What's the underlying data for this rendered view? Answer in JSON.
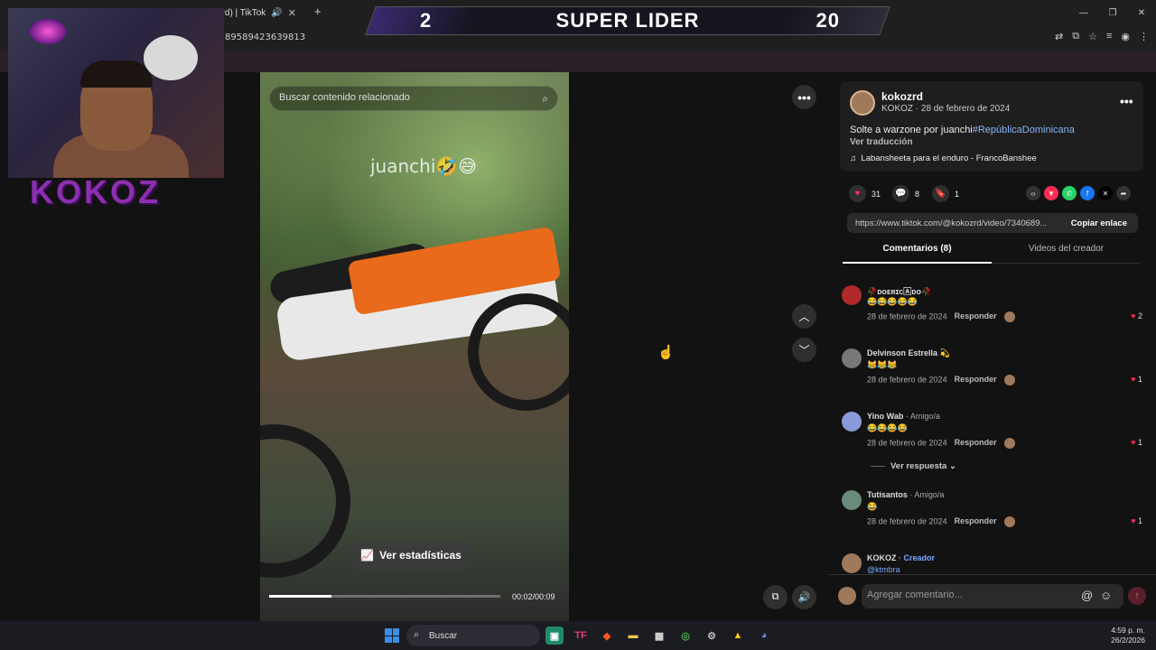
{
  "browser": {
    "tab_title": "kozrd) | TikTok",
    "url": "89589423639813"
  },
  "overlay": {
    "left_score": "2",
    "title": "SUPER LIDER",
    "right_score": "20",
    "streamer_logo": "KOKOZ"
  },
  "video": {
    "search_placeholder": "Buscar contenido relacionado",
    "caption": "juanchi🤣😅",
    "stats_button": "Ver estadísticas",
    "time": "00:02/00:09",
    "progress": 0.27
  },
  "post": {
    "username": "kokozrd",
    "subtitle": "KOKOZ · 28 de febrero de 2024",
    "text_before": "Solte a warzone por juanchi",
    "hashtag": "#RepúblicaDominicana",
    "translate": "Ver traducción",
    "music": "Labansheeta para el enduro - FrancoBanshee",
    "likes": "31",
    "comments": "8",
    "saves": "1",
    "link": "https://www.tiktok.com/@kokozrd/video/7340689...",
    "copy_label": "Copiar enlace"
  },
  "tabs": {
    "comments": "Comentarios (8)",
    "creator_videos": "Videos del creador"
  },
  "comments": [
    {
      "name": "🥀ᴅᴏᴇʀɪᴄ🄰ᴅᴏ🥀",
      "label": "",
      "text": "😂😂😂😂😂",
      "date": "28 de febrero de 2024",
      "reply": "Responder",
      "likes": "2",
      "avatar_color": "#b02a2a"
    },
    {
      "name": "Delvinson Estrella 💫",
      "label": "",
      "text": "😹😹😹",
      "date": "28 de febrero de 2024",
      "reply": "Responder",
      "likes": "1",
      "avatar_color": "#777777"
    },
    {
      "name": "Yino Wab",
      "label": " · Amigo/a",
      "text": "😂😂😂😂",
      "date": "28 de febrero de 2024",
      "reply": "Responder",
      "likes": "1",
      "avatar_color": "#8a9ad8"
    },
    {
      "name": "Tutisantos",
      "label": " · Amigo/a",
      "text": "😂",
      "date": "28 de febrero de 2024",
      "reply": "Responder",
      "likes": "1",
      "avatar_color": "#6a8a7a"
    }
  ],
  "more_replies": "Ver respuesta ⌄",
  "creator_comment": {
    "name": "KOKOZ",
    "label": " · Creador",
    "text": "@ktmbra"
  },
  "comment_input_placeholder": "Agregar comentario...",
  "taskbar": {
    "search_label": "Buscar",
    "time": "4:59 p. m.",
    "date": "26/2/2026"
  },
  "colors": {
    "accent": "#fe2c55",
    "hashtag": "#8ab4f8"
  }
}
